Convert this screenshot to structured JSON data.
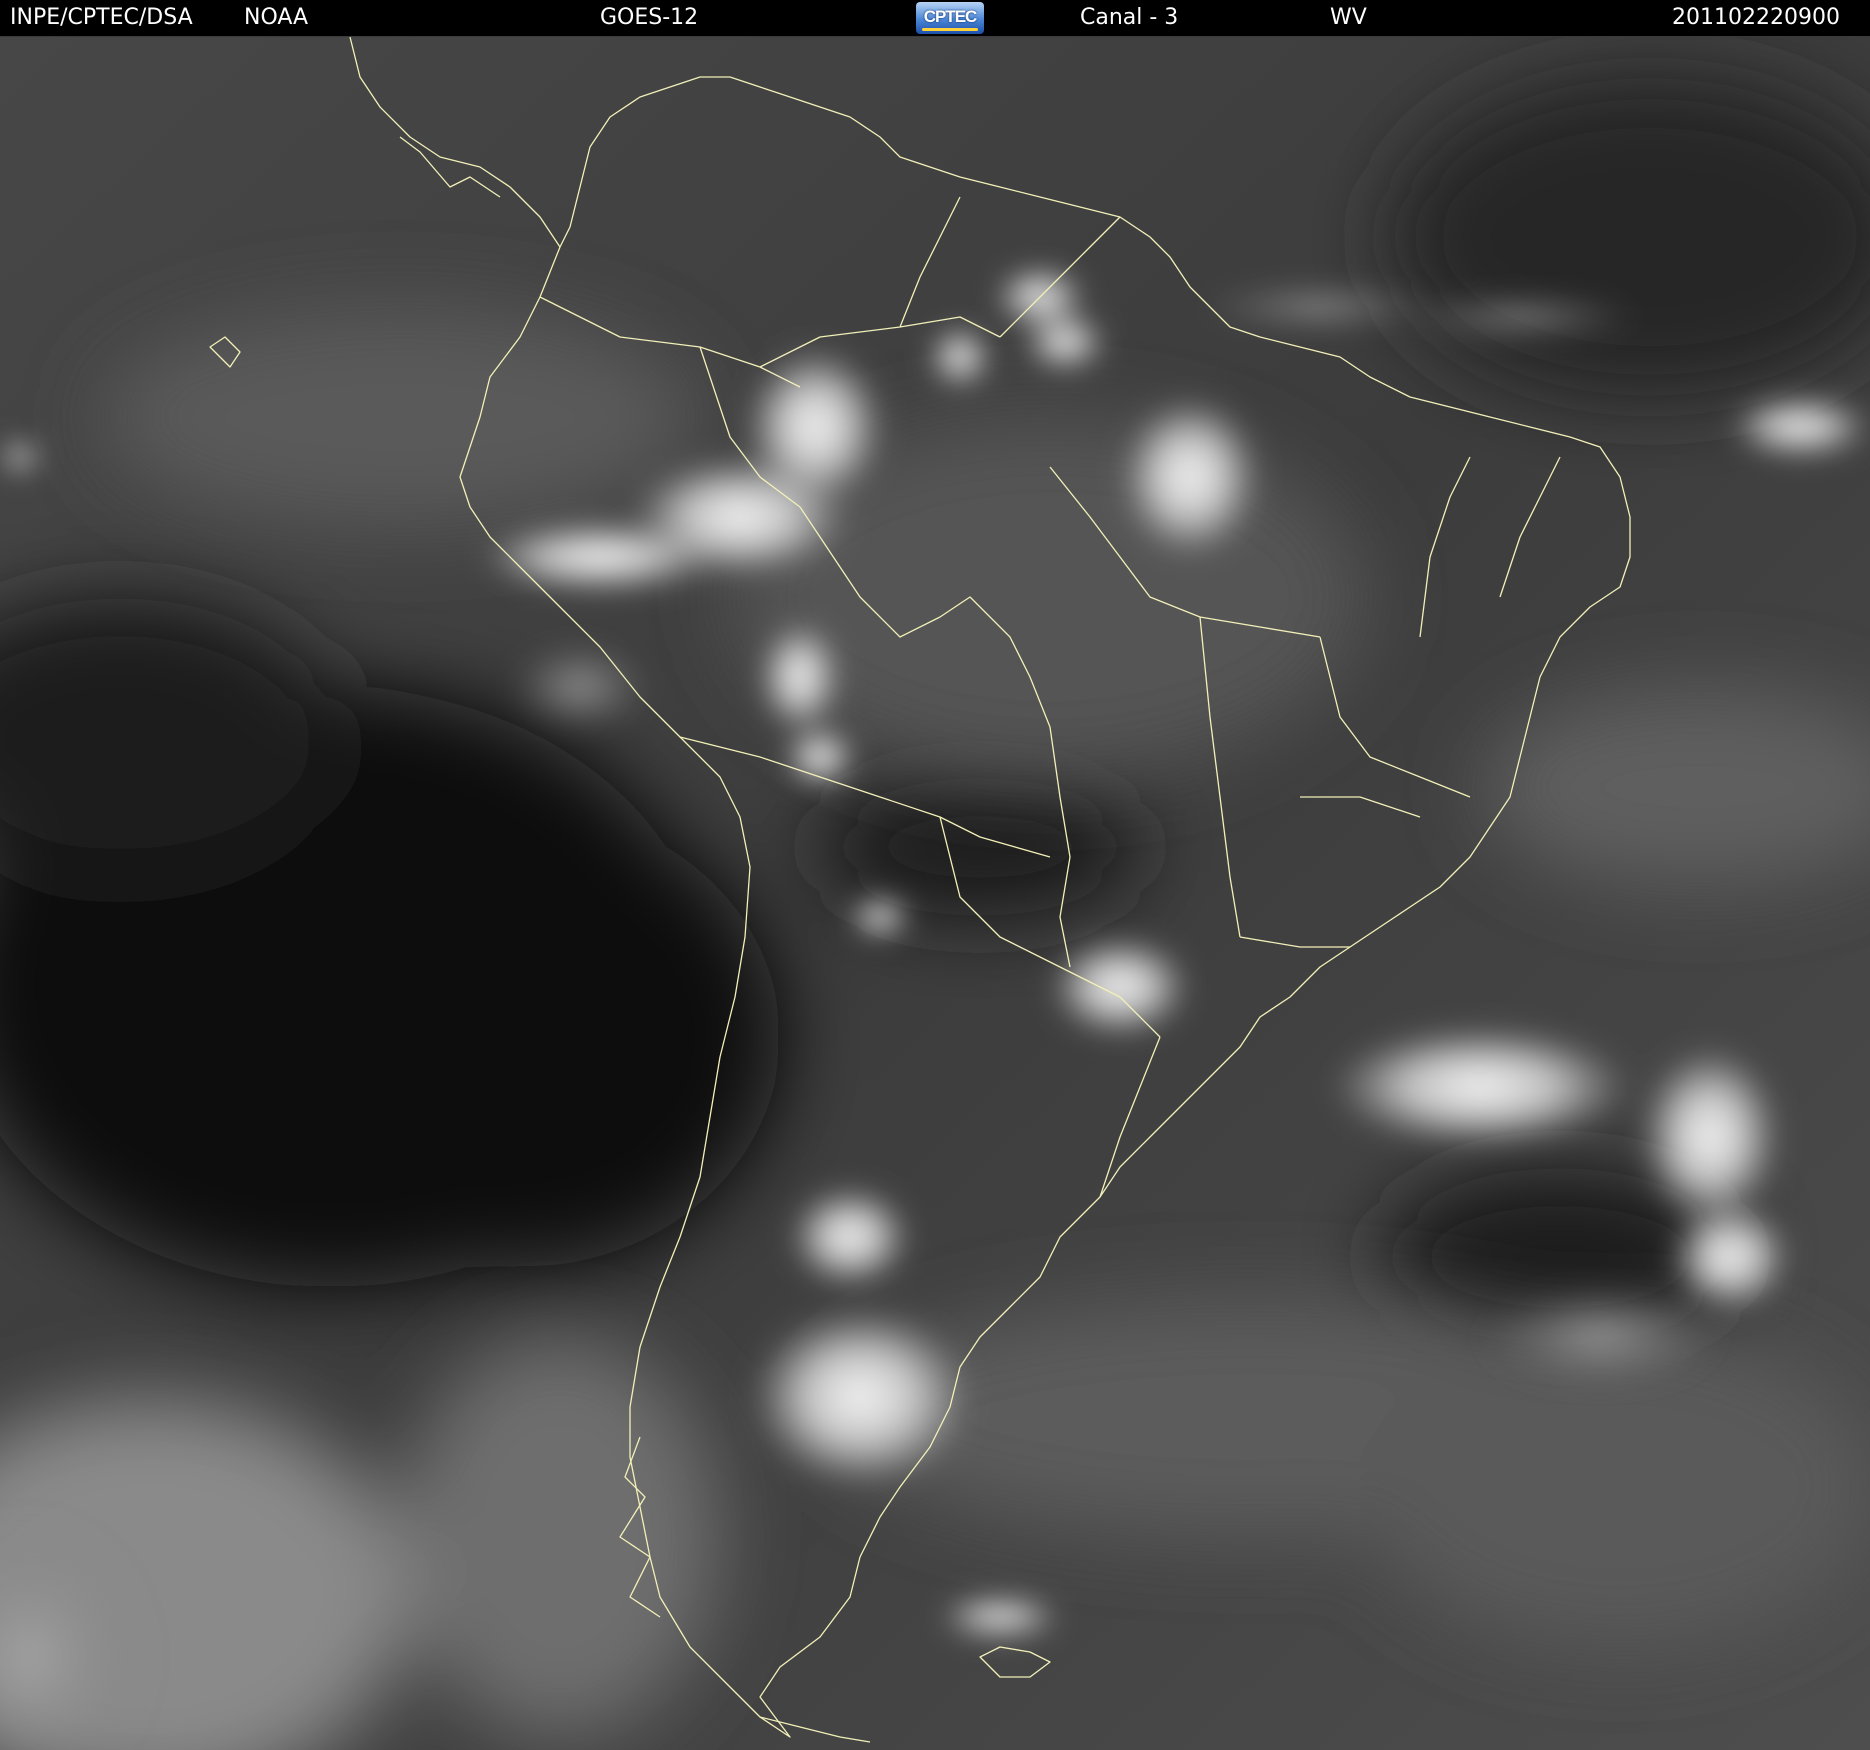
{
  "header": {
    "organization": "INPE/CPTEC/DSA",
    "agency": "NOAA",
    "satellite": "GOES-12",
    "logo_text": "CPTEC",
    "channel": "Canal - 3",
    "band": "WV",
    "timestamp": "201102220900"
  },
  "colors": {
    "header_background": "#000000",
    "header_text": "#ffffff",
    "border_lines": "#f2f0b8",
    "dry_air": "#0d0d0d",
    "moist_air": "#7a7a7a",
    "cloud_tops": "#f4f4f4"
  },
  "map": {
    "region": "South America",
    "imagery": "water vapor satellite image, grayscale"
  }
}
